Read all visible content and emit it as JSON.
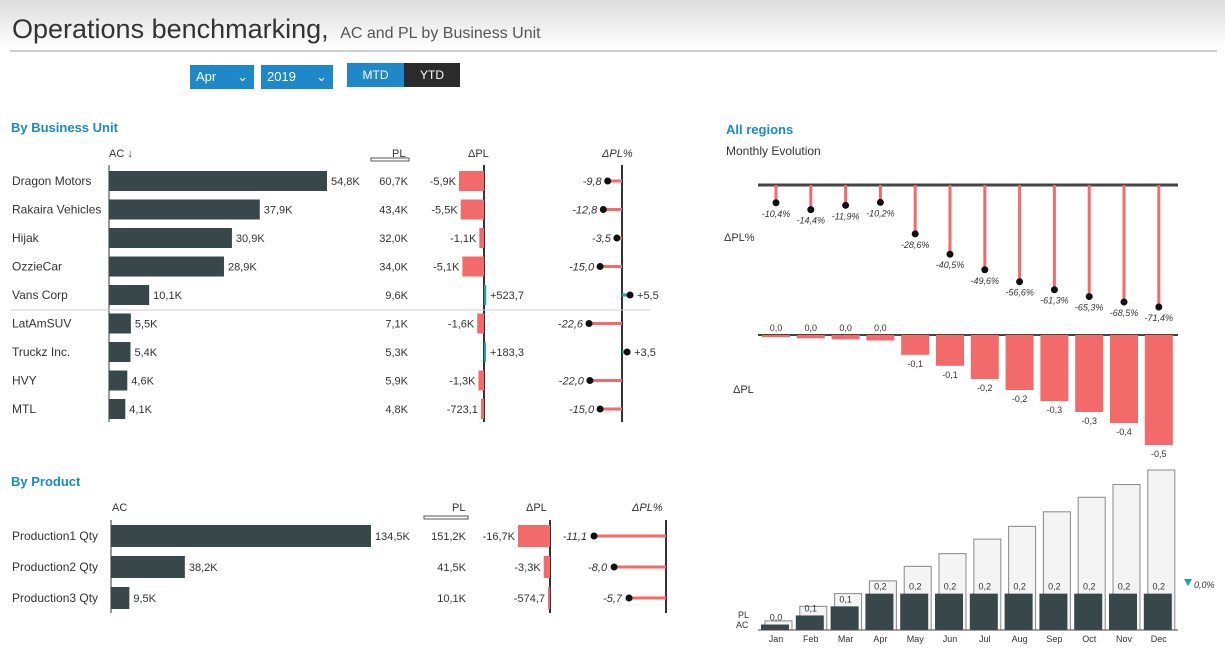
{
  "header": {
    "title": "Operations benchmarking,",
    "subtitle": "AC and PL by Business Unit"
  },
  "filters": {
    "month": "Apr",
    "year": "2019",
    "mtd_label": "MTD",
    "ytd_label": "YTD"
  },
  "colors": {
    "ac_bar": "#37474a",
    "negative": "#f26a6a",
    "positive": "#1aa6a0",
    "accent": "#1a8ac3",
    "pl_bar": "#f4f4f4"
  },
  "business_unit": {
    "section_title": "By Business Unit",
    "col_ac": "AC ↓",
    "col_pl": "PL",
    "col_dpl": "ΔPL",
    "col_dplpct": "ΔPL%",
    "rows": [
      {
        "name": "Dragon Motors",
        "ac": 54.8,
        "ac_label": "54,8K",
        "pl_label": "60,7K",
        "dpl": -5.9,
        "dpl_label": "-5,9K",
        "dplpct": -9.8,
        "dplpct_label": "-9,8"
      },
      {
        "name": "Rakaira Vehicles",
        "ac": 37.9,
        "ac_label": "37,9K",
        "pl_label": "43,4K",
        "dpl": -5.5,
        "dpl_label": "-5,5K",
        "dplpct": -12.8,
        "dplpct_label": "-12,8"
      },
      {
        "name": "Hijak",
        "ac": 30.9,
        "ac_label": "30,9K",
        "pl_label": "32,0K",
        "dpl": -1.1,
        "dpl_label": "-1,1K",
        "dplpct": -3.5,
        "dplpct_label": "-3,5"
      },
      {
        "name": "OzzieCar",
        "ac": 28.9,
        "ac_label": "28,9K",
        "pl_label": "34,0K",
        "dpl": -5.1,
        "dpl_label": "-5,1K",
        "dplpct": -15.0,
        "dplpct_label": "-15,0"
      },
      {
        "name": "Vans Corp",
        "ac": 10.1,
        "ac_label": "10,1K",
        "pl_label": "9,6K",
        "dpl": 0.5237,
        "dpl_label": "+523,7",
        "dplpct": 5.5,
        "dplpct_label": "+5,5"
      },
      {
        "name": "LatAmSUV",
        "ac": 5.5,
        "ac_label": "5,5K",
        "pl_label": "7,1K",
        "dpl": -1.6,
        "dpl_label": "-1,6K",
        "dplpct": -22.6,
        "dplpct_label": "-22,6"
      },
      {
        "name": "Truckz Inc.",
        "ac": 5.4,
        "ac_label": "5,4K",
        "pl_label": "5,3K",
        "dpl": 0.1833,
        "dpl_label": "+183,3",
        "dplpct": 3.5,
        "dplpct_label": "+3,5"
      },
      {
        "name": "HVY",
        "ac": 4.6,
        "ac_label": "4,6K",
        "pl_label": "5,9K",
        "dpl": -1.3,
        "dpl_label": "-1,3K",
        "dplpct": -22.0,
        "dplpct_label": "-22,0"
      },
      {
        "name": "MTL",
        "ac": 4.1,
        "ac_label": "4,1K",
        "pl_label": "4,8K",
        "dpl": -0.7231,
        "dpl_label": "-723,1",
        "dplpct": -15.0,
        "dplpct_label": "-15,0"
      }
    ]
  },
  "product": {
    "section_title": "By Product",
    "col_ac": "AC",
    "col_pl": "PL",
    "col_dpl": "ΔPL",
    "col_dplpct": "ΔPL%",
    "rows": [
      {
        "name": "Production1 Qty",
        "ac": 134.5,
        "ac_label": "134,5K",
        "pl_label": "151,2K",
        "dpl": -16.7,
        "dpl_label": "-16,7K",
        "dplpct": -11.1,
        "dplpct_label": "-11,1"
      },
      {
        "name": "Production2 Qty",
        "ac": 38.2,
        "ac_label": "38,2K",
        "pl_label": "41,5K",
        "dpl": -3.3,
        "dpl_label": "-3,3K",
        "dplpct": -8.0,
        "dplpct_label": "-8,0"
      },
      {
        "name": "Production3 Qty",
        "ac": 9.5,
        "ac_label": "9,5K",
        "pl_label": "10,1K",
        "dpl": -0.5747,
        "dpl_label": "-574,7",
        "dplpct": -5.7,
        "dplpct_label": "-5,7"
      }
    ]
  },
  "regions": {
    "section_title": "All regions",
    "subtitle": "Monthly Evolution",
    "dplpct_label": "ΔPL%",
    "dpl_label": "ΔPL",
    "pl_label": "PL",
    "ac_label": "AC",
    "end_label": "0,0%"
  },
  "chart_data": [
    {
      "type": "bar",
      "title": "ΔPL%",
      "categories": [
        "Jan",
        "Feb",
        "Mar",
        "Apr",
        "May",
        "Jun",
        "Jul",
        "Aug",
        "Sep",
        "Oct",
        "Nov",
        "Dec"
      ],
      "values": [
        -10.4,
        -14.4,
        -11.9,
        -10.2,
        -28.6,
        -40.5,
        -49.6,
        -56.6,
        -61.3,
        -65.3,
        -68.5,
        -71.4
      ],
      "labels": [
        "-10,4%",
        "-14,4%",
        "-11,9%",
        "-10,2%",
        "-28,6%",
        "-40,5%",
        "-49,6%",
        "-56,6%",
        "-61,3%",
        "-65,3%",
        "-68,5%",
        "-71,4%"
      ]
    },
    {
      "type": "bar",
      "title": "ΔPL",
      "categories": [
        "Jan",
        "Feb",
        "Mar",
        "Apr",
        "May",
        "Jun",
        "Jul",
        "Aug",
        "Sep",
        "Oct",
        "Nov",
        "Dec"
      ],
      "values": [
        -0.01,
        -0.015,
        -0.02,
        -0.025,
        -0.09,
        -0.14,
        -0.2,
        -0.25,
        -0.3,
        -0.35,
        -0.4,
        -0.5
      ],
      "labels": [
        "0,0",
        "0,0",
        "0,0",
        "0,0",
        "-0,1",
        "-0,1",
        "-0,2",
        "-0,2",
        "-0,3",
        "-0,3",
        "-0,4",
        "-0,5"
      ]
    },
    {
      "type": "bar",
      "categories": [
        "Jan",
        "Feb",
        "Mar",
        "Apr",
        "May",
        "Jun",
        "Jul",
        "Aug",
        "Sep",
        "Oct",
        "Nov",
        "Dec"
      ],
      "series": [
        {
          "name": "PL",
          "values": [
            0.05,
            0.13,
            0.2,
            0.27,
            0.35,
            0.42,
            0.5,
            0.57,
            0.65,
            0.73,
            0.8,
            0.88
          ]
        },
        {
          "name": "AC",
          "values": [
            0.03,
            0.08,
            0.13,
            0.2,
            0.2,
            0.2,
            0.2,
            0.2,
            0.2,
            0.2,
            0.2,
            0.2
          ]
        }
      ],
      "labels": [
        "0,0",
        "0,1",
        "0,1",
        "0,2",
        "0,2",
        "0,2",
        "0,2",
        "0,2",
        "0,2",
        "0,2",
        "0,2",
        "0,2"
      ]
    }
  ]
}
